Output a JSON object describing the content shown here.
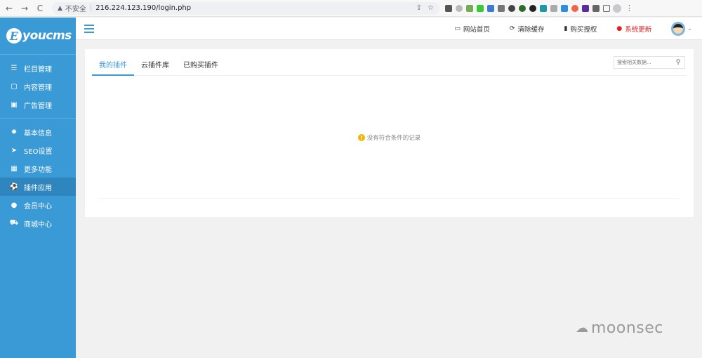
{
  "browser": {
    "back": "←",
    "forward": "→",
    "reload": "C",
    "insecure_label": "不安全",
    "url": "216.224.123.190/login.php"
  },
  "sidebar": {
    "logo_letter": "E",
    "logo_text": "youcms",
    "groups": [
      [
        {
          "label": "栏目管理",
          "icon": "☰",
          "icon_name": "list-icon"
        },
        {
          "label": "内容管理",
          "icon": "▢",
          "icon_name": "document-icon"
        },
        {
          "label": "广告管理",
          "icon": "▣",
          "icon_name": "image-icon"
        }
      ],
      [
        {
          "label": "基本信息",
          "icon": "✹",
          "icon_name": "gear-icon"
        },
        {
          "label": "SEO设置",
          "icon": "➤",
          "icon_name": "send-icon"
        },
        {
          "label": "更多功能",
          "icon": "▦",
          "icon_name": "grid-icon"
        },
        {
          "label": "插件应用",
          "icon": "⚽",
          "icon_name": "plugin-icon",
          "active": true
        },
        {
          "label": "会员中心",
          "icon": "●",
          "icon_name": "user-icon"
        },
        {
          "label": "商城中心",
          "icon": "⛟",
          "icon_name": "cart-icon"
        }
      ]
    ]
  },
  "header": {
    "links": [
      {
        "label": "网站首页",
        "icon": "▭",
        "icon_name": "monitor-icon"
      },
      {
        "label": "清除缓存",
        "icon": "⟳",
        "icon_name": "refresh-icon"
      },
      {
        "label": "购买授权",
        "icon": "▮",
        "icon_name": "bookmark-icon"
      },
      {
        "label": "系统更新",
        "icon": "●",
        "icon_name": "info-icon",
        "alert": true
      }
    ],
    "caret": "⌄"
  },
  "main": {
    "tabs": [
      {
        "label": "我的插件",
        "active": true
      },
      {
        "label": "云插件库"
      },
      {
        "label": "已购买插件"
      }
    ],
    "search_placeholder": "搜索相关数据...",
    "empty_icon": "!",
    "empty_text": "没有符合条件的记录"
  },
  "watermark": {
    "text": "moonsec"
  },
  "colors": {
    "accent": "#3a9ad6",
    "alert": "#e02020",
    "warning": "#f5b400"
  }
}
